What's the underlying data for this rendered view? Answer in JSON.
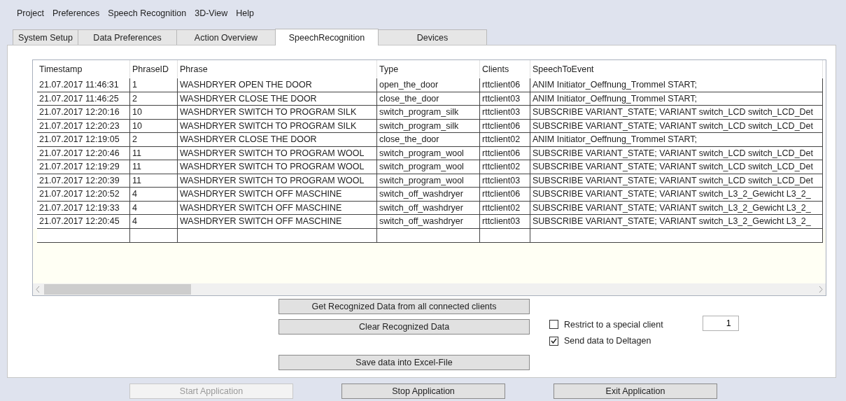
{
  "menu": [
    "Project",
    "Preferences",
    "Speech Recognition",
    "3D-View",
    "Help"
  ],
  "tabs": [
    {
      "label": "System Setup",
      "selected": false
    },
    {
      "label": "Data Preferences",
      "selected": false
    },
    {
      "label": "Action Overview",
      "selected": false
    },
    {
      "label": "SpeechRecognition",
      "selected": true
    },
    {
      "label": "Devices",
      "selected": false
    }
  ],
  "table": {
    "columns": [
      "Timestamp",
      "PhraseID",
      "Phrase",
      "Type",
      "Clients",
      "SpeechToEvent"
    ],
    "rows": [
      [
        "21.07.2017 11:46:31",
        "1",
        "WASHDRYER OPEN THE DOOR",
        "open_the_door",
        "rttclient06",
        "ANIM Initiator_Oeffnung_Trommel START;"
      ],
      [
        "21.07.2017 11:46:25",
        "2",
        "WASHDRYER CLOSE THE DOOR",
        "close_the_door",
        "rttclient03",
        "ANIM Initiator_Oeffnung_Trommel START;"
      ],
      [
        "21.07.2017 12:20:16",
        "10",
        "WASHDRYER SWITCH TO PROGRAM SILK",
        "switch_program_silk",
        "rttclient03",
        "SUBSCRIBE VARIANT_STATE; VARIANT switch_LCD switch_LCD_Det"
      ],
      [
        "21.07.2017 12:20:23",
        "10",
        "WASHDRYER SWITCH TO PROGRAM SILK",
        "switch_program_silk",
        "rttclient06",
        "SUBSCRIBE VARIANT_STATE; VARIANT switch_LCD switch_LCD_Det"
      ],
      [
        "21.07.2017 12:19:05",
        "2",
        "WASHDRYER CLOSE THE DOOR",
        "close_the_door",
        "rttclient02",
        "ANIM Initiator_Oeffnung_Trommel START;"
      ],
      [
        "21.07.2017 12:20:46",
        "11",
        "WASHDRYER SWITCH TO PROGRAM WOOL",
        "switch_program_wool",
        "rttclient06",
        "SUBSCRIBE VARIANT_STATE; VARIANT switch_LCD switch_LCD_Det"
      ],
      [
        "21.07.2017 12:19:29",
        "11",
        "WASHDRYER SWITCH TO PROGRAM WOOL",
        "switch_program_wool",
        "rttclient02",
        "SUBSCRIBE VARIANT_STATE; VARIANT switch_LCD switch_LCD_Det"
      ],
      [
        "21.07.2017 12:20:39",
        "11",
        "WASHDRYER SWITCH TO PROGRAM WOOL",
        "switch_program_wool",
        "rttclient03",
        "SUBSCRIBE VARIANT_STATE; VARIANT switch_LCD switch_LCD_Det"
      ],
      [
        "21.07.2017 12:20:52",
        "4",
        "WASHDRYER SWITCH OFF MASCHINE",
        "switch_off_washdryer",
        "rttclient06",
        "SUBSCRIBE VARIANT_STATE; VARIANT switch_L3_2_Gewicht L3_2_"
      ],
      [
        "21.07.2017 12:19:33",
        "4",
        "WASHDRYER SWITCH OFF MASCHINE",
        "switch_off_washdryer",
        "rttclient02",
        "SUBSCRIBE VARIANT_STATE; VARIANT switch_L3_2_Gewicht L3_2_"
      ],
      [
        "21.07.2017 12:20:45",
        "4",
        "WASHDRYER SWITCH OFF MASCHINE",
        "switch_off_washdryer",
        "rttclient03",
        "SUBSCRIBE VARIANT_STATE; VARIANT switch_L3_2_Gewicht L3_2_"
      ]
    ]
  },
  "actions": [
    "Get Recognized Data from all connected clients",
    "Clear Recognized Data",
    "Save data into Excel-File"
  ],
  "options": [
    {
      "label": "Restrict to a special client",
      "checked": false
    },
    {
      "label": "Send data to Deltagen",
      "checked": true
    }
  ],
  "client_field": {
    "value": "1"
  },
  "app_buttons": [
    {
      "label": "Start Application",
      "disabled": true
    },
    {
      "label": "Stop Application",
      "disabled": false
    },
    {
      "label": "Exit Application",
      "disabled": false
    }
  ]
}
